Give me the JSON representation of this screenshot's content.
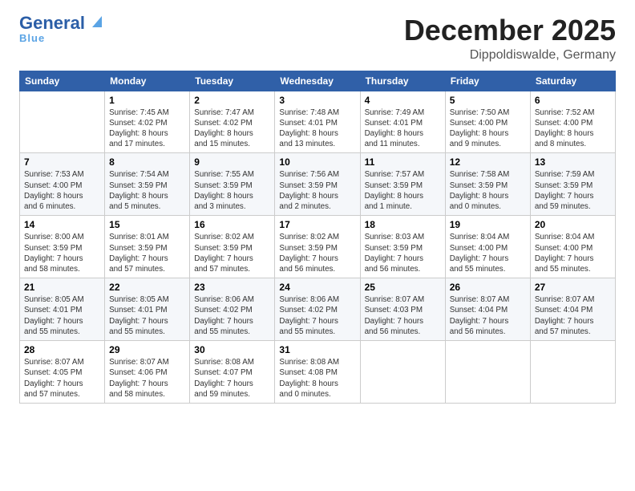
{
  "logo": {
    "line1": "General",
    "line2": "Blue"
  },
  "title": "December 2025",
  "subtitle": "Dippoldiswalde, Germany",
  "days_of_week": [
    "Sunday",
    "Monday",
    "Tuesday",
    "Wednesday",
    "Thursday",
    "Friday",
    "Saturday"
  ],
  "weeks": [
    [
      {
        "day": "",
        "info": ""
      },
      {
        "day": "1",
        "info": "Sunrise: 7:45 AM\nSunset: 4:02 PM\nDaylight: 8 hours\nand 17 minutes."
      },
      {
        "day": "2",
        "info": "Sunrise: 7:47 AM\nSunset: 4:02 PM\nDaylight: 8 hours\nand 15 minutes."
      },
      {
        "day": "3",
        "info": "Sunrise: 7:48 AM\nSunset: 4:01 PM\nDaylight: 8 hours\nand 13 minutes."
      },
      {
        "day": "4",
        "info": "Sunrise: 7:49 AM\nSunset: 4:01 PM\nDaylight: 8 hours\nand 11 minutes."
      },
      {
        "day": "5",
        "info": "Sunrise: 7:50 AM\nSunset: 4:00 PM\nDaylight: 8 hours\nand 9 minutes."
      },
      {
        "day": "6",
        "info": "Sunrise: 7:52 AM\nSunset: 4:00 PM\nDaylight: 8 hours\nand 8 minutes."
      }
    ],
    [
      {
        "day": "7",
        "info": "Sunrise: 7:53 AM\nSunset: 4:00 PM\nDaylight: 8 hours\nand 6 minutes."
      },
      {
        "day": "8",
        "info": "Sunrise: 7:54 AM\nSunset: 3:59 PM\nDaylight: 8 hours\nand 5 minutes."
      },
      {
        "day": "9",
        "info": "Sunrise: 7:55 AM\nSunset: 3:59 PM\nDaylight: 8 hours\nand 3 minutes."
      },
      {
        "day": "10",
        "info": "Sunrise: 7:56 AM\nSunset: 3:59 PM\nDaylight: 8 hours\nand 2 minutes."
      },
      {
        "day": "11",
        "info": "Sunrise: 7:57 AM\nSunset: 3:59 PM\nDaylight: 8 hours\nand 1 minute."
      },
      {
        "day": "12",
        "info": "Sunrise: 7:58 AM\nSunset: 3:59 PM\nDaylight: 8 hours\nand 0 minutes."
      },
      {
        "day": "13",
        "info": "Sunrise: 7:59 AM\nSunset: 3:59 PM\nDaylight: 7 hours\nand 59 minutes."
      }
    ],
    [
      {
        "day": "14",
        "info": "Sunrise: 8:00 AM\nSunset: 3:59 PM\nDaylight: 7 hours\nand 58 minutes."
      },
      {
        "day": "15",
        "info": "Sunrise: 8:01 AM\nSunset: 3:59 PM\nDaylight: 7 hours\nand 57 minutes."
      },
      {
        "day": "16",
        "info": "Sunrise: 8:02 AM\nSunset: 3:59 PM\nDaylight: 7 hours\nand 57 minutes."
      },
      {
        "day": "17",
        "info": "Sunrise: 8:02 AM\nSunset: 3:59 PM\nDaylight: 7 hours\nand 56 minutes."
      },
      {
        "day": "18",
        "info": "Sunrise: 8:03 AM\nSunset: 3:59 PM\nDaylight: 7 hours\nand 56 minutes."
      },
      {
        "day": "19",
        "info": "Sunrise: 8:04 AM\nSunset: 4:00 PM\nDaylight: 7 hours\nand 55 minutes."
      },
      {
        "day": "20",
        "info": "Sunrise: 8:04 AM\nSunset: 4:00 PM\nDaylight: 7 hours\nand 55 minutes."
      }
    ],
    [
      {
        "day": "21",
        "info": "Sunrise: 8:05 AM\nSunset: 4:01 PM\nDaylight: 7 hours\nand 55 minutes."
      },
      {
        "day": "22",
        "info": "Sunrise: 8:05 AM\nSunset: 4:01 PM\nDaylight: 7 hours\nand 55 minutes."
      },
      {
        "day": "23",
        "info": "Sunrise: 8:06 AM\nSunset: 4:02 PM\nDaylight: 7 hours\nand 55 minutes."
      },
      {
        "day": "24",
        "info": "Sunrise: 8:06 AM\nSunset: 4:02 PM\nDaylight: 7 hours\nand 55 minutes."
      },
      {
        "day": "25",
        "info": "Sunrise: 8:07 AM\nSunset: 4:03 PM\nDaylight: 7 hours\nand 56 minutes."
      },
      {
        "day": "26",
        "info": "Sunrise: 8:07 AM\nSunset: 4:04 PM\nDaylight: 7 hours\nand 56 minutes."
      },
      {
        "day": "27",
        "info": "Sunrise: 8:07 AM\nSunset: 4:04 PM\nDaylight: 7 hours\nand 57 minutes."
      }
    ],
    [
      {
        "day": "28",
        "info": "Sunrise: 8:07 AM\nSunset: 4:05 PM\nDaylight: 7 hours\nand 57 minutes."
      },
      {
        "day": "29",
        "info": "Sunrise: 8:07 AM\nSunset: 4:06 PM\nDaylight: 7 hours\nand 58 minutes."
      },
      {
        "day": "30",
        "info": "Sunrise: 8:08 AM\nSunset: 4:07 PM\nDaylight: 7 hours\nand 59 minutes."
      },
      {
        "day": "31",
        "info": "Sunrise: 8:08 AM\nSunset: 4:08 PM\nDaylight: 8 hours\nand 0 minutes."
      },
      {
        "day": "",
        "info": ""
      },
      {
        "day": "",
        "info": ""
      },
      {
        "day": "",
        "info": ""
      }
    ]
  ]
}
